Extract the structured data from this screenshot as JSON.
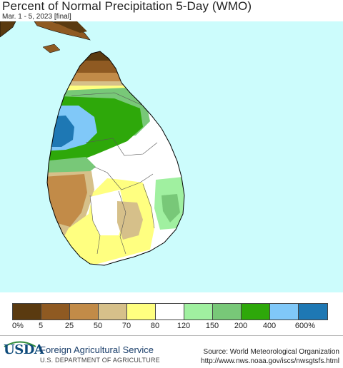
{
  "title": "Percent of Normal Precipitation 5-Day (WMO)",
  "subtitle": "Mar. 1 - 5, 2023 [final]",
  "colors": {
    "ocean": "#ccfcfc",
    "c0_5": "#5a3a10",
    "c5_25": "#8f5a22",
    "c25_50": "#c28b48",
    "c50_70": "#d6c08a",
    "c70_80": "#ffff80",
    "c80_120": "#ffffff",
    "c120_150": "#a0f0a0",
    "c150_200": "#78c878",
    "c200_400": "#2ea80a",
    "c400_600": "#80c8f8",
    "c600_plus": "#1e78b4"
  },
  "legend": {
    "colors": [
      "#5a3a10",
      "#8f5a22",
      "#c28b48",
      "#d6c08a",
      "#ffff80",
      "#ffffff",
      "#a0f0a0",
      "#78c878",
      "#2ea80a",
      "#80c8f8",
      "#1e78b4"
    ],
    "ticks": [
      "0%",
      "5",
      "25",
      "50",
      "70",
      "80",
      "120",
      "150",
      "200",
      "400",
      "600%"
    ]
  },
  "footer": {
    "logo": "USDA",
    "agency": "Foreign Agricultural Service",
    "department": "U.S. DEPARTMENT OF AGRICULTURE",
    "source": "Source: World Meteorological Organization",
    "url": "http://www.nws.noaa.gov/iscs/nwsgtsfs.html"
  }
}
